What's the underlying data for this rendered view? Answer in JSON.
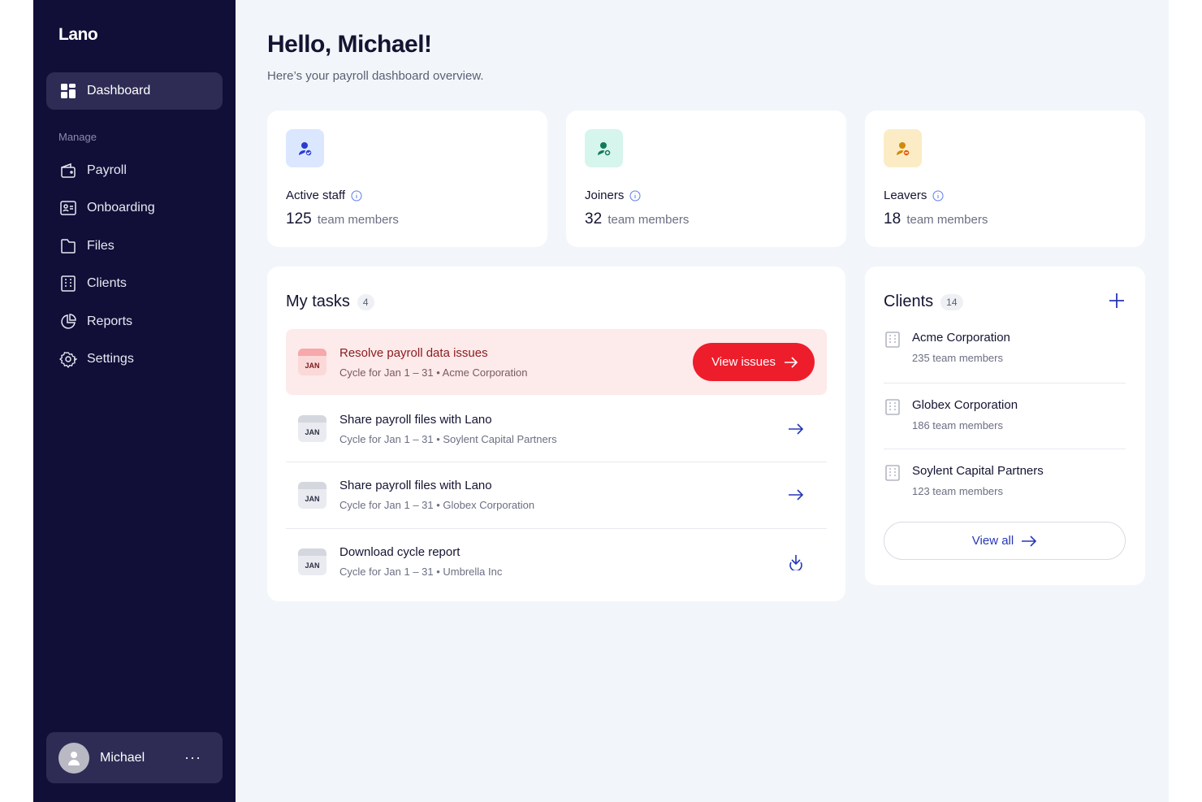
{
  "app": {
    "logo": "Lano"
  },
  "sidebar": {
    "primary": {
      "label": "Dashboard",
      "icon": "grid-icon"
    },
    "section_label": "Manage",
    "items": [
      {
        "label": "Payroll",
        "icon": "wallet-icon"
      },
      {
        "label": "Onboarding",
        "icon": "id-card-icon"
      },
      {
        "label": "Files",
        "icon": "folder-icon"
      },
      {
        "label": "Clients",
        "icon": "building-icon"
      },
      {
        "label": "Reports",
        "icon": "pie-chart-icon"
      },
      {
        "label": "Settings",
        "icon": "gear-icon"
      }
    ],
    "user": {
      "name": "Michael",
      "more": "···"
    }
  },
  "header": {
    "greeting": "Hello, Michael!",
    "subtitle": "Here’s your payroll dashboard overview."
  },
  "stats": [
    {
      "label": "Active staff",
      "value": "125",
      "unit": "team members",
      "icon": "user-check-icon",
      "color": "#dbe7ff",
      "accent": "#2a3bd1"
    },
    {
      "label": "Joiners",
      "value": "32",
      "unit": "team members",
      "icon": "user-plus-icon",
      "color": "#d6f5ec",
      "accent": "#127a5a"
    },
    {
      "label": "Leavers",
      "value": "18",
      "unit": "team members",
      "icon": "user-minus-icon",
      "color": "#fcecc6",
      "accent": "#d08a08"
    }
  ],
  "tasks": {
    "title": "My tasks",
    "count": "4",
    "items": [
      {
        "month": "JAN",
        "title": "Resolve payroll data issues",
        "subtitle": "Cycle for Jan 1 – 31 • Acme Corporation",
        "action": "View issues"
      },
      {
        "month": "JAN",
        "title": "Share payroll files with Lano",
        "subtitle": "Cycle for Jan 1 – 31 • Soylent Capital Partners"
      },
      {
        "month": "JAN",
        "title": "Share payroll files with Lano",
        "subtitle": "Cycle for Jan 1 – 31 • Globex Corporation"
      },
      {
        "month": "JAN",
        "title": "Download cycle report",
        "subtitle": "Cycle for Jan 1 – 31 • Umbrella Inc"
      }
    ]
  },
  "clients": {
    "title": "Clients",
    "count": "14",
    "items": [
      {
        "name": "Acme Corporation",
        "members": "235 team members"
      },
      {
        "name": "Globex Corporation",
        "members": "186 team members"
      },
      {
        "name": "Soylent Capital Partners",
        "members": "123 team members"
      }
    ],
    "view_all": "View all"
  },
  "colors": {
    "sidebar_bg": "#110f38",
    "accent_red": "#ee1d2c",
    "link_blue": "#2637b8"
  }
}
